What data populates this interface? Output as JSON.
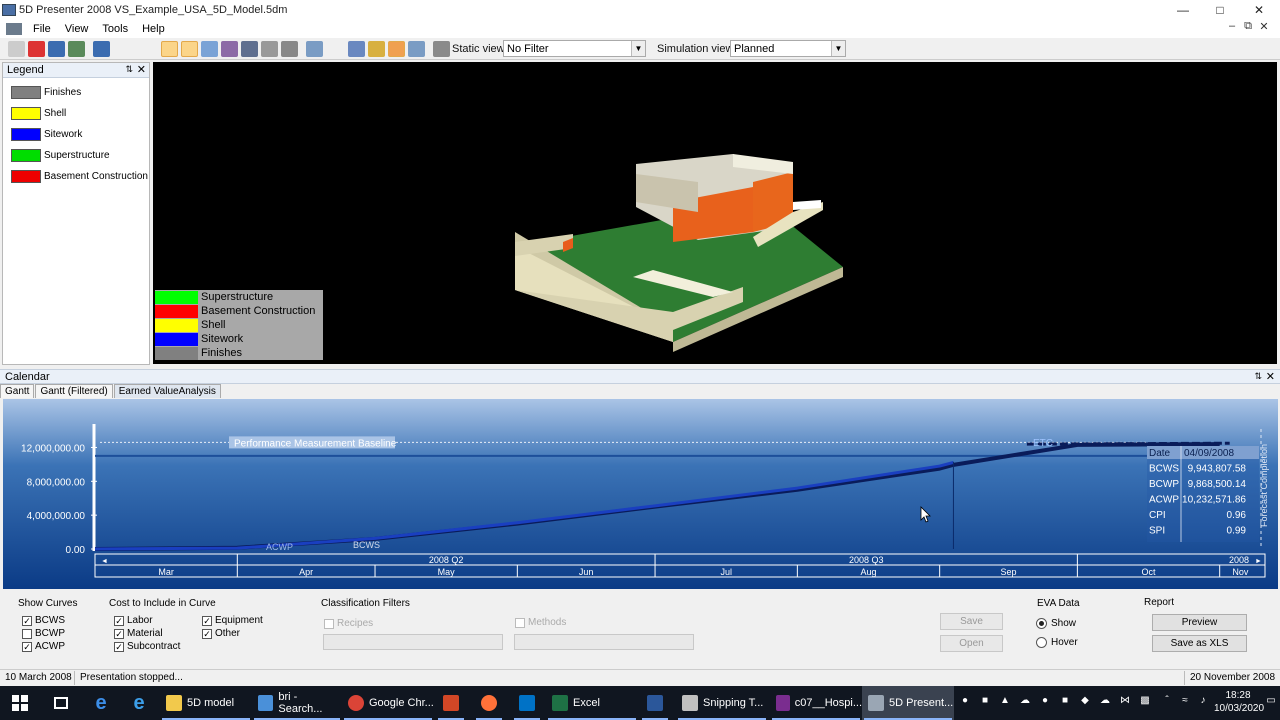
{
  "window": {
    "title": "5D Presenter 2008   VS_Example_USA_5D_Model.5dm"
  },
  "menu": [
    "File",
    "View",
    "Tools",
    "Help"
  ],
  "toolbar": {
    "static_view_label": "Static view",
    "filter_value": "No Filter",
    "simulation_view_label": "Simulation view",
    "simulation_value": "Planned"
  },
  "legend_panel": {
    "title": "Legend",
    "items": [
      {
        "label": "Finishes",
        "color": "#808080"
      },
      {
        "label": "Shell",
        "color": "#ffff00"
      },
      {
        "label": "Sitework",
        "color": "#0000ff"
      },
      {
        "label": "Superstructure",
        "color": "#00dd00"
      },
      {
        "label": "Basement Construction",
        "color": "#ee0000"
      }
    ]
  },
  "viewport_legend": [
    {
      "label": "Superstructure",
      "color": "#00ff00"
    },
    {
      "label": "Basement Construction",
      "color": "#ff0000"
    },
    {
      "label": "Shell",
      "color": "#ffff00"
    },
    {
      "label": "Sitework",
      "color": "#0000ff"
    },
    {
      "label": "Finishes",
      "color": "#808080"
    }
  ],
  "calendar": {
    "title": "Calendar",
    "tabs": [
      "Gantt",
      "Gantt (Filtered)",
      "Earned ValueAnalysis"
    ],
    "active_tab": 2
  },
  "chart_data": {
    "type": "line",
    "ylim": [
      0,
      13000000
    ],
    "yticks": [
      "12,000,000.00",
      "8,000,000.00",
      "4,000,000.00",
      "0.00"
    ],
    "ytick_values": [
      12000000,
      8000000,
      4000000,
      0
    ],
    "baseline_label": "Performance Measurement Baseline",
    "baseline_value": 12600000,
    "etc_label": "ETC",
    "series_labels": [
      "ACWP",
      "BCWS"
    ],
    "quarters": [
      "2008 Q2",
      "2008 Q3",
      "2008"
    ],
    "months": [
      "Mar",
      "Apr",
      "May",
      "Jun",
      "Jul",
      "Aug",
      "Sep",
      "Oct",
      "Nov"
    ],
    "x": [
      "2008-03-01",
      "2008-04-01",
      "2008-05-01",
      "2008-06-01",
      "2008-07-01",
      "2008-08-01",
      "2008-09-01",
      "2008-09-04",
      "2008-10-01",
      "2008-11-01"
    ],
    "series": [
      {
        "name": "BCWS",
        "values": [
          0,
          150000,
          1200000,
          3000000,
          5000000,
          7000000,
          9500000,
          9943807.58,
          12300000,
          12400000
        ]
      },
      {
        "name": "ACWP",
        "values": [
          0,
          100000,
          1250000,
          3100000,
          5100000,
          7200000,
          9800000,
          10232571.86,
          null,
          null
        ]
      }
    ],
    "cursor_date": "2008-09-04",
    "readout": [
      {
        "label": "Date",
        "value": "04/09/2008"
      },
      {
        "label": "BCWS",
        "value": "9,943,807.58"
      },
      {
        "label": "BCWP",
        "value": "9,868,500.14"
      },
      {
        "label": "ACWP",
        "value": "10,232,571.86"
      },
      {
        "label": "CPI",
        "value": "0.96"
      },
      {
        "label": "SPI",
        "value": "0.99"
      }
    ],
    "side_label": "Forecast Completion"
  },
  "controls": {
    "show_curves": {
      "title": "Show Curves",
      "items": [
        {
          "label": "BCWS",
          "checked": true
        },
        {
          "label": "BCWP",
          "checked": false
        },
        {
          "label": "ACWP",
          "checked": true
        }
      ]
    },
    "cost": {
      "title": "Cost to Include in Curve",
      "items": [
        {
          "label": "Labor",
          "checked": true
        },
        {
          "label": "Material",
          "checked": true
        },
        {
          "label": "Subcontract",
          "checked": true
        },
        {
          "label": "Equipment",
          "checked": true
        },
        {
          "label": "Other",
          "checked": true
        }
      ]
    },
    "classification": {
      "title": "Classification Filters",
      "recipes": "Recipes",
      "methods": "Methods"
    },
    "save": "Save",
    "open": "Open",
    "eva": {
      "title": "EVA Data",
      "show": "Show",
      "hover": "Hover",
      "selected": "Show"
    },
    "report": {
      "title": "Report",
      "preview": "Preview",
      "save_xls": "Save as XLS"
    }
  },
  "status": {
    "left": "10 March 2008",
    "message": "Presentation stopped...",
    "right": "20 November 2008"
  },
  "taskbar": {
    "items": [
      "5D model",
      "bri - Search...",
      "Google Chr...",
      "Excel",
      "Snipping T...",
      "c07__Hospi...",
      "5D Present..."
    ],
    "time": "18:28",
    "date": "10/03/2020"
  }
}
